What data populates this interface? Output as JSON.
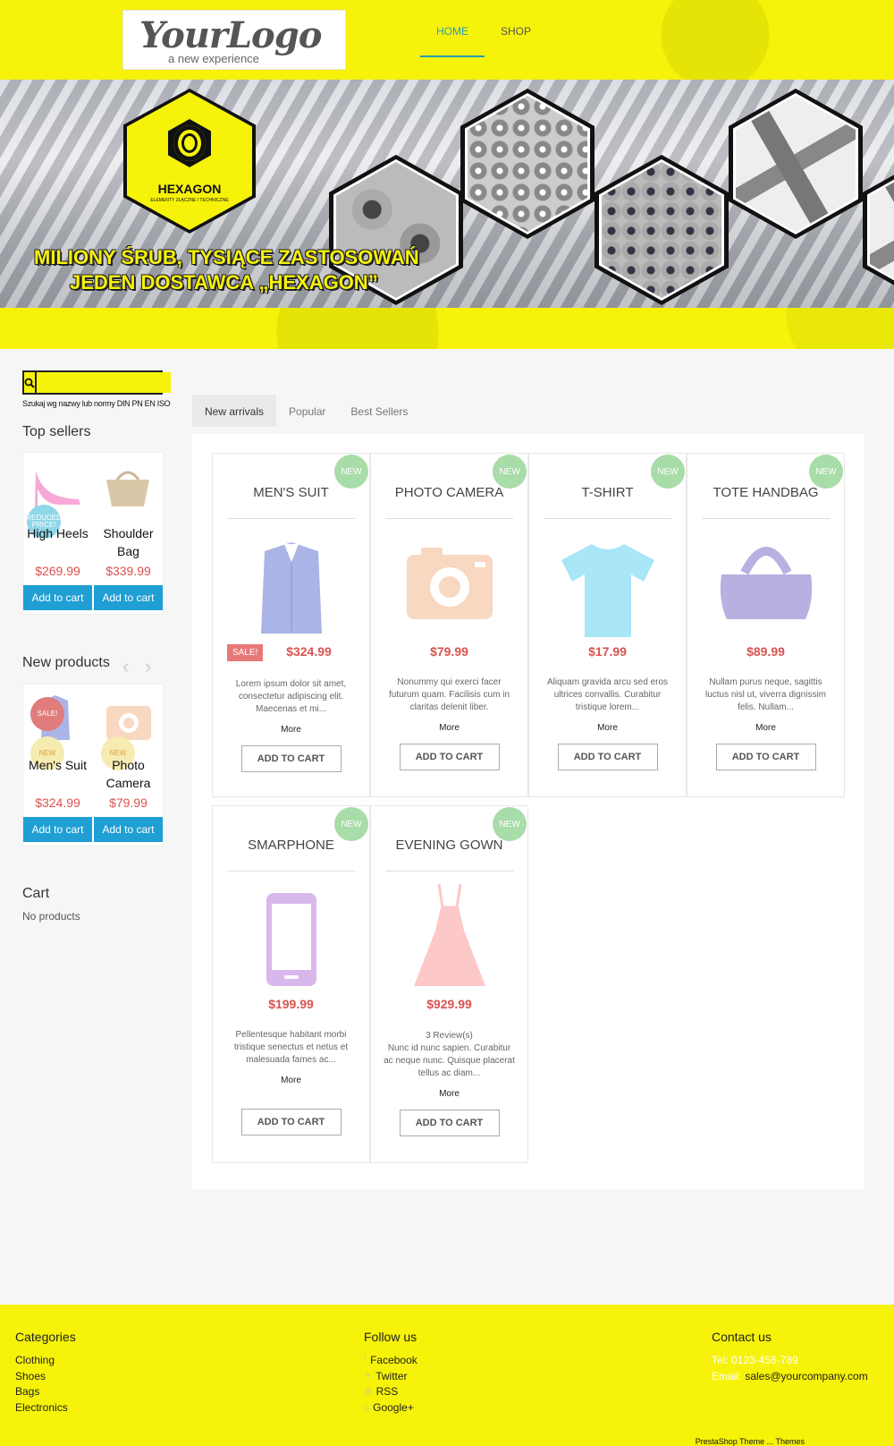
{
  "header": {
    "logo_main": "YourLogo",
    "logo_sub": "a new experience",
    "nav": [
      {
        "label": "HOME"
      },
      {
        "label": "SHOP"
      }
    ]
  },
  "banner": {
    "brand": "HEXAGON",
    "brand_sub": "ELEMENTY ZŁĄCZNE I TECHNICZNE",
    "slogan_line1": "MILIONY ŚRUB, TYSIĄCE ZASTOSOWAŃ",
    "slogan_line2": "JEDEN DOSTAWCA „HEXAGON”"
  },
  "sidebar": {
    "search_placeholder": "",
    "search_hint": "Szukaj wg nazwy lub normy DIN PN EN ISO",
    "top_sellers": {
      "title": "Top sellers",
      "items": [
        {
          "name": "High Heels",
          "price": "$269.99",
          "badge": "REDUCED PRICE!",
          "add": "Add to cart"
        },
        {
          "name": "Shoulder Bag",
          "price": "$339.99",
          "add": "Add to cart"
        }
      ]
    },
    "new_products": {
      "title": "New products",
      "items": [
        {
          "name": "Men's Suit",
          "price": "$324.99",
          "badge": "SALE!",
          "badge2": "NEW",
          "add": "Add to cart"
        },
        {
          "name": "Photo Camera",
          "price": "$79.99",
          "badge": "NEW",
          "add": "Add to cart"
        }
      ]
    },
    "cart": {
      "title": "Cart",
      "empty": "No products"
    }
  },
  "tabs": [
    {
      "label": "New arrivals"
    },
    {
      "label": "Popular"
    },
    {
      "label": "Best Sellers"
    }
  ],
  "products": [
    {
      "title": "MEN'S SUIT",
      "price": "$324.99",
      "sale": "SALE!",
      "desc": "Lorem ipsum dolor sit amet, consectetur adipiscing elit. Maecenas et mi...",
      "more": "More",
      "add": "ADD TO CART",
      "badge": "NEW"
    },
    {
      "title": "PHOTO CAMERA",
      "price": "$79.99",
      "desc": "Nonummy qui exerci facer futurum quam. Facilisis cum in claritas delenit liber.",
      "more": "More",
      "add": "ADD TO CART",
      "badge": "NEW"
    },
    {
      "title": "T-SHIRT",
      "price": "$17.99",
      "desc": "Aliquam gravida arcu sed eros ultrices convallis. Curabitur tristique lorem...",
      "more": "More",
      "add": "ADD TO CART",
      "badge": "NEW"
    },
    {
      "title": "TOTE HANDBAG",
      "price": "$89.99",
      "desc": "Nullam purus neque, sagittis luctus nisl ut, viverra dignissim felis. Nullam...",
      "more": "More",
      "add": "ADD TO CART",
      "badge": "NEW"
    },
    {
      "title": "SMARPHONE",
      "price": "$199.99",
      "desc": "Pellentesque habitant morbi tristique senectus et netus et malesuada fames ac...",
      "more": "More",
      "add": "ADD TO CART",
      "badge": "NEW"
    },
    {
      "title": "EVENING GOWN",
      "price": "$929.99",
      "reviews": "3 Review(s)",
      "desc": "Nunc id nunc sapien. Curabitur ac neque nunc. Quisque placerat tellus ac diam...",
      "more": "More",
      "add": "ADD TO CART",
      "badge": "NEW"
    }
  ],
  "footer": {
    "categories": {
      "title": "Categories",
      "items": [
        "Clothing",
        "Shoes",
        "Bags",
        "Electronics"
      ]
    },
    "follow": {
      "title": "Follow us",
      "items": [
        "Facebook",
        "Twitter",
        "RSS",
        "Google+"
      ]
    },
    "contact": {
      "title": "Contact us",
      "tel": "Tel: 0123-456-789",
      "email_label": "Email:",
      "email": "sales@yourcompany.com"
    },
    "credit": "PrestaShop Theme ... Themes"
  },
  "colors": {
    "brand_yellow": "#f6f20a",
    "price_red": "#d9534f",
    "cart_blue": "#1f9fd4",
    "nav_accent": "#2a9db0",
    "badge_green": "#a8dca8"
  }
}
